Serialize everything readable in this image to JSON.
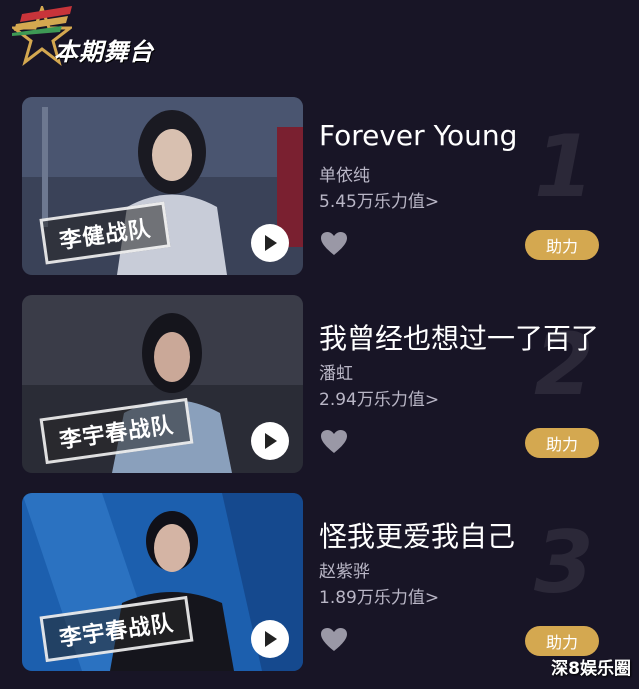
{
  "header": {
    "title": "本期舞台"
  },
  "performances": [
    {
      "rank": "1",
      "song": "Forever Young",
      "singer": "单依纯",
      "power": "5.45万乐力值>",
      "team": "李健战队",
      "boost_label": "助力",
      "bg": "#3a4258"
    },
    {
      "rank": "2",
      "song": "我曾经也想过一了百了",
      "singer": "潘虹",
      "power": "2.94万乐力值>",
      "team": "李宇春战队",
      "boost_label": "助力",
      "bg": "#2a2c36"
    },
    {
      "rank": "3",
      "song": "怪我更爱我自己",
      "singer": "赵紫骅",
      "power": "1.89万乐力值>",
      "team": "李宇春战队",
      "boost_label": "助力",
      "bg": "#1c5fae"
    }
  ],
  "watermark": "深8娱乐圈",
  "colors": {
    "background": "#181526",
    "accent": "#d4a850",
    "muted_text": "#b9b6c6"
  },
  "icons": [
    "star-icon",
    "play-icon",
    "heart-icon"
  ]
}
